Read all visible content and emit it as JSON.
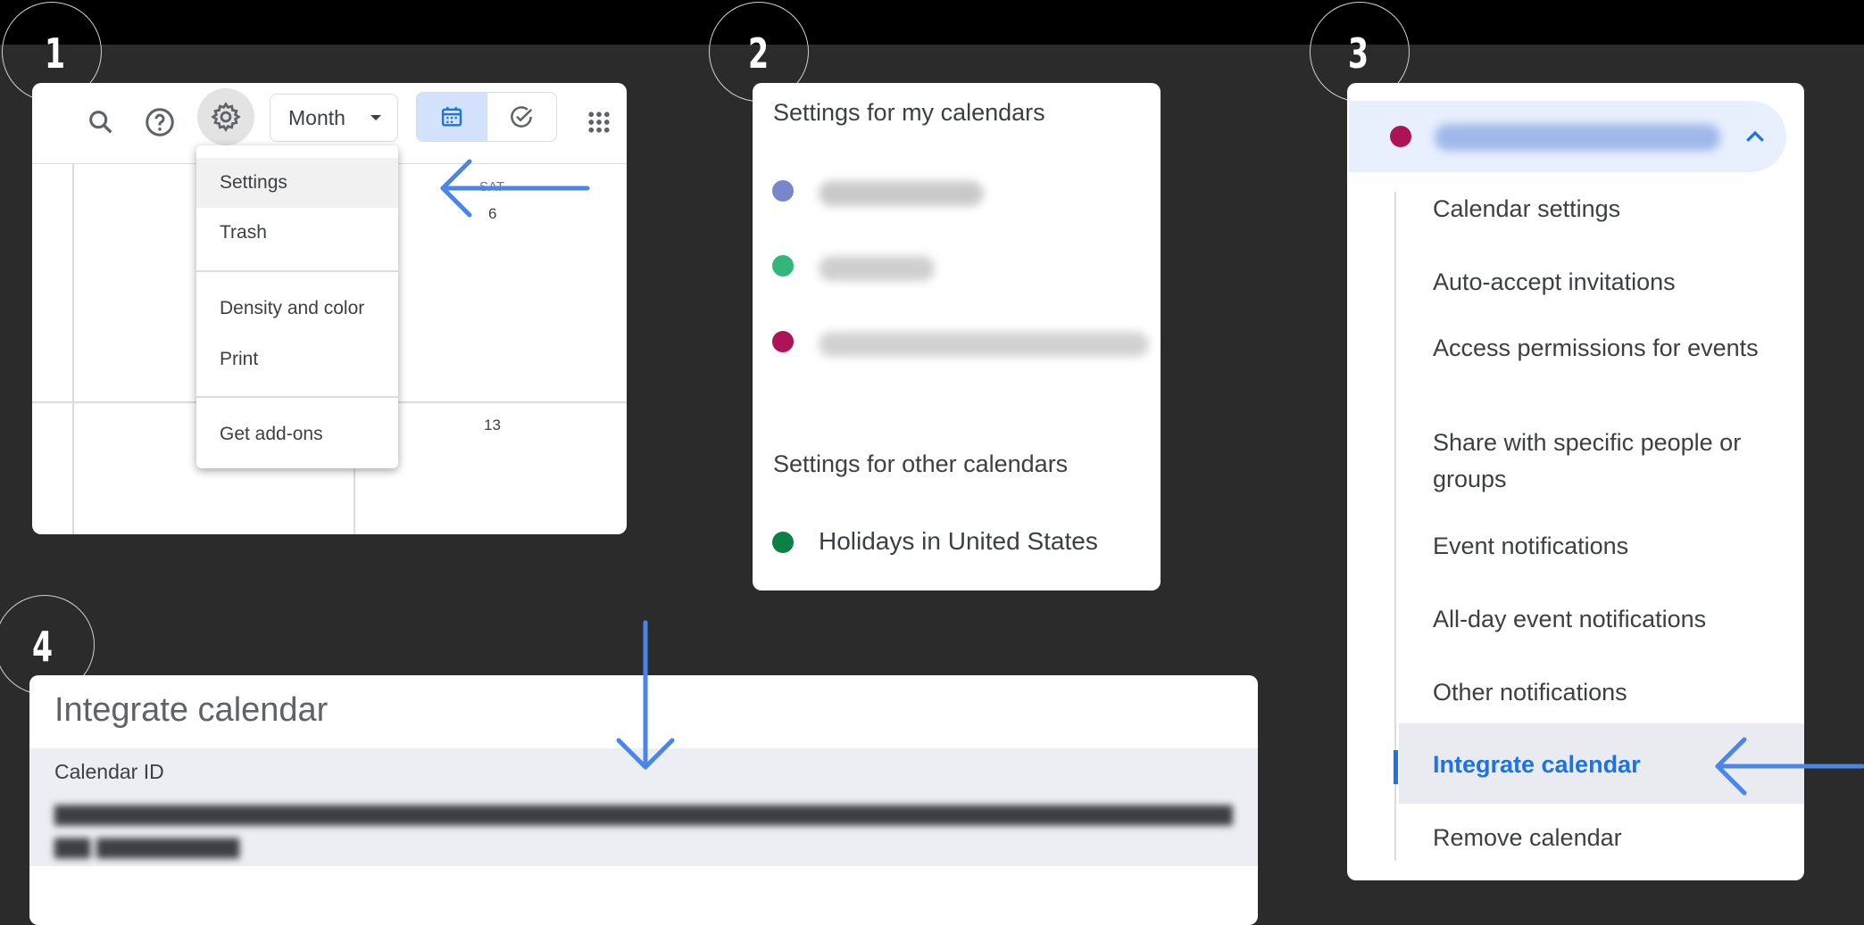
{
  "steps": [
    "1",
    "2",
    "3",
    "4"
  ],
  "toolbar": {
    "view_label": "Month",
    "icons": [
      "search-icon",
      "help-icon",
      "gear-icon",
      "calendar-view-icon",
      "tasks-icon",
      "apps-grid-icon"
    ]
  },
  "calendar_grid": {
    "day_label": "SAT",
    "day_numbers": [
      "6",
      "13"
    ]
  },
  "settings_menu": {
    "items": [
      "Settings",
      "Trash",
      "Density and color",
      "Print",
      "Get add-ons"
    ],
    "highlighted": "Settings"
  },
  "my_calendars": {
    "heading": "Settings for my calendars",
    "item_colors": [
      "#7986cb",
      "#33b679",
      "#ad1457"
    ]
  },
  "other_calendars": {
    "heading": "Settings for other calendars",
    "items": [
      {
        "label": "Holidays in United States",
        "color": "#0b8043"
      }
    ]
  },
  "calendar_settings_nav": {
    "calendar_color": "#ad1457",
    "items": [
      "Calendar settings",
      "Auto-accept invitations",
      "Access permissions for events",
      "Share with specific people or groups",
      "Event notifications",
      "All-day event notifications",
      "Other notifications",
      "Integrate calendar",
      "Remove calendar"
    ],
    "active_item": "Integrate calendar"
  },
  "integrate": {
    "title": "Integrate calendar",
    "calendar_id_label": "Calendar ID"
  },
  "colors": {
    "accent": "#1a73e8",
    "arrow": "#4a86e8"
  }
}
